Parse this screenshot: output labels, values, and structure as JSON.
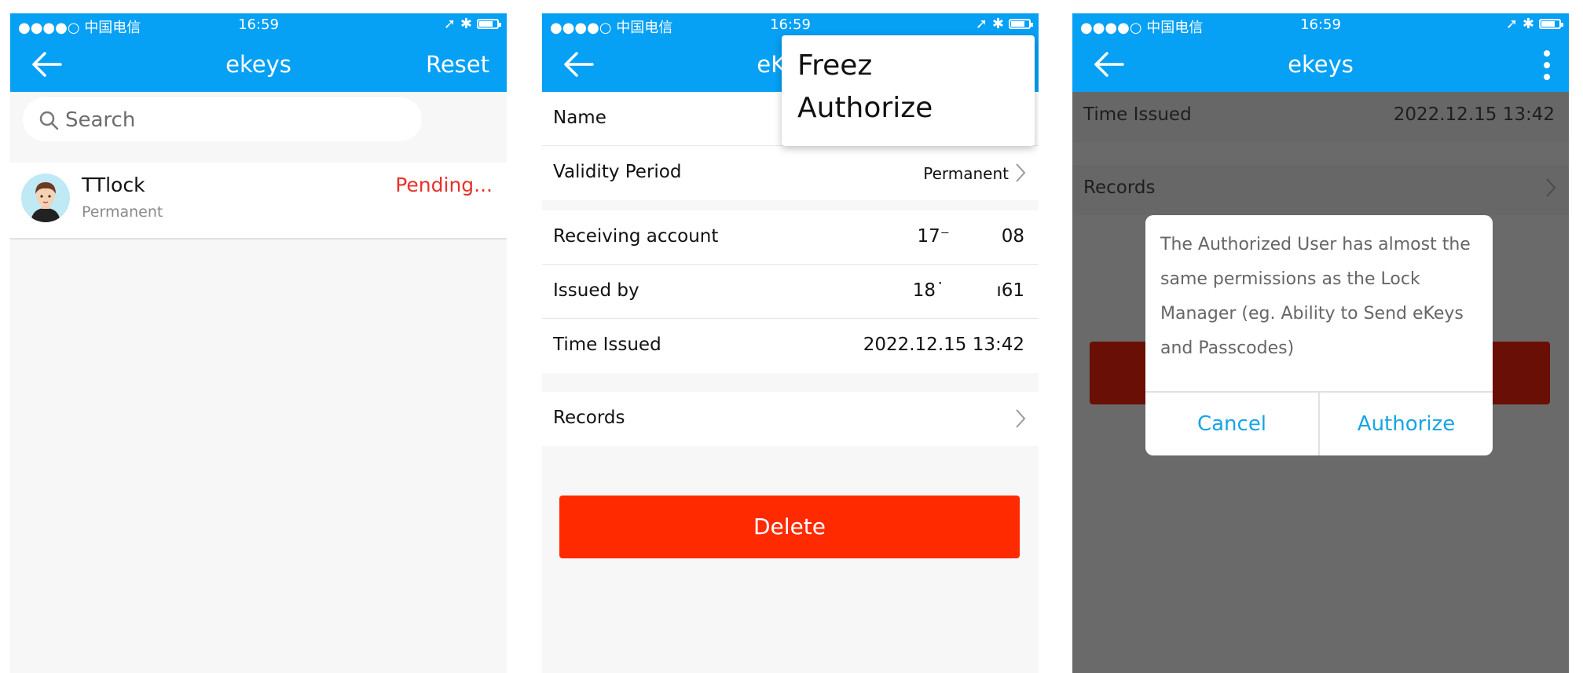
{
  "colors": {
    "primary": "#06a0f5",
    "danger": "#ff2a00",
    "pending": "#e8312b",
    "link": "#16a4e6"
  },
  "status_bar": {
    "signal": "●●●●○ 中国电信",
    "time": "16:59"
  },
  "screen1": {
    "nav": {
      "title": "ekeys",
      "action": "Reset"
    },
    "search": {
      "placeholder": "Search"
    },
    "list": [
      {
        "name": "TTlock",
        "sub": "Permanent",
        "status": "Pending..."
      }
    ]
  },
  "screen2": {
    "nav": {
      "title": "eKeys"
    },
    "popup_menu": [
      "Freez",
      "Authorize"
    ],
    "rows": [
      {
        "label": "Name",
        "value": ""
      },
      {
        "label": "Validity Period",
        "value": "Permanent"
      },
      {
        "label": "Receiving account",
        "value": "17⁻         08"
      },
      {
        "label": "Issued by",
        "value": "18˙         ı61"
      },
      {
        "label": "Time Issued",
        "value": "2022.12.15 13:42"
      }
    ],
    "records": "Records",
    "delete": "Delete"
  },
  "screen3": {
    "nav": {
      "title": "ekeys"
    },
    "time_issued": {
      "label": "Time Issued",
      "value": "2022.12.15 13:42"
    },
    "records": "Records",
    "dialog": {
      "message": "The Authorized User has almost the same permissions as the Lock Manager (eg. Ability to Send eKeys and Passcodes)",
      "cancel": "Cancel",
      "confirm": "Authorize"
    }
  }
}
